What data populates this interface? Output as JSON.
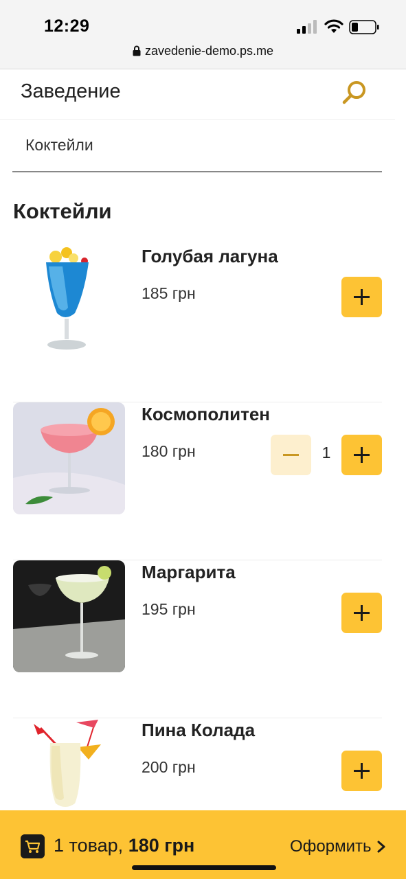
{
  "status_bar": {
    "time": "12:29",
    "url": "zavedenie-demo.ps.me"
  },
  "header": {
    "title": "Заведение",
    "search_icon": "search-icon"
  },
  "tabs": [
    {
      "label": "Коктейли",
      "active": true
    }
  ],
  "section": {
    "title": "Коктейли"
  },
  "items": [
    {
      "name": "Голубая лагуна",
      "price": "185 грн",
      "quantity": null
    },
    {
      "name": "Космополитен",
      "price": "180 грн",
      "quantity": "1"
    },
    {
      "name": "Маргарита",
      "price": "195 грн",
      "quantity": null
    },
    {
      "name": "Пина Колада",
      "price": "200 грн",
      "quantity": null
    }
  ],
  "cart": {
    "count_text": "1 товар, ",
    "total": "180 грн",
    "checkout_label": "Оформить"
  },
  "colors": {
    "accent": "#fdc334",
    "accent_light": "#fdefce",
    "search_icon": "#c99722"
  }
}
